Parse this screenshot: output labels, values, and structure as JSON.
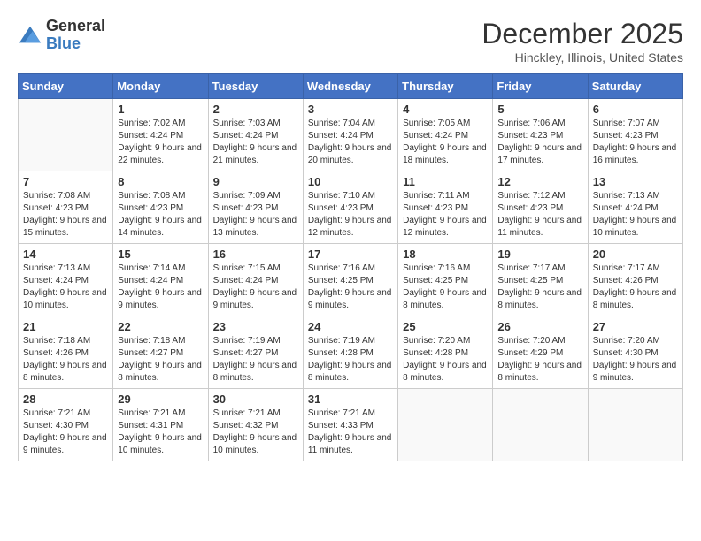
{
  "header": {
    "logo": {
      "general": "General",
      "blue": "Blue"
    },
    "title": "December 2025",
    "location": "Hinckley, Illinois, United States"
  },
  "calendar": {
    "days_of_week": [
      "Sunday",
      "Monday",
      "Tuesday",
      "Wednesday",
      "Thursday",
      "Friday",
      "Saturday"
    ],
    "weeks": [
      [
        {
          "day": null,
          "sunrise": null,
          "sunset": null,
          "daylight": null
        },
        {
          "day": "1",
          "sunrise": "7:02 AM",
          "sunset": "4:24 PM",
          "daylight": "9 hours and 22 minutes."
        },
        {
          "day": "2",
          "sunrise": "7:03 AM",
          "sunset": "4:24 PM",
          "daylight": "9 hours and 21 minutes."
        },
        {
          "day": "3",
          "sunrise": "7:04 AM",
          "sunset": "4:24 PM",
          "daylight": "9 hours and 20 minutes."
        },
        {
          "day": "4",
          "sunrise": "7:05 AM",
          "sunset": "4:24 PM",
          "daylight": "9 hours and 18 minutes."
        },
        {
          "day": "5",
          "sunrise": "7:06 AM",
          "sunset": "4:23 PM",
          "daylight": "9 hours and 17 minutes."
        },
        {
          "day": "6",
          "sunrise": "7:07 AM",
          "sunset": "4:23 PM",
          "daylight": "9 hours and 16 minutes."
        }
      ],
      [
        {
          "day": "7",
          "sunrise": "7:08 AM",
          "sunset": "4:23 PM",
          "daylight": "9 hours and 15 minutes."
        },
        {
          "day": "8",
          "sunrise": "7:08 AM",
          "sunset": "4:23 PM",
          "daylight": "9 hours and 14 minutes."
        },
        {
          "day": "9",
          "sunrise": "7:09 AM",
          "sunset": "4:23 PM",
          "daylight": "9 hours and 13 minutes."
        },
        {
          "day": "10",
          "sunrise": "7:10 AM",
          "sunset": "4:23 PM",
          "daylight": "9 hours and 12 minutes."
        },
        {
          "day": "11",
          "sunrise": "7:11 AM",
          "sunset": "4:23 PM",
          "daylight": "9 hours and 12 minutes."
        },
        {
          "day": "12",
          "sunrise": "7:12 AM",
          "sunset": "4:23 PM",
          "daylight": "9 hours and 11 minutes."
        },
        {
          "day": "13",
          "sunrise": "7:13 AM",
          "sunset": "4:24 PM",
          "daylight": "9 hours and 10 minutes."
        }
      ],
      [
        {
          "day": "14",
          "sunrise": "7:13 AM",
          "sunset": "4:24 PM",
          "daylight": "9 hours and 10 minutes."
        },
        {
          "day": "15",
          "sunrise": "7:14 AM",
          "sunset": "4:24 PM",
          "daylight": "9 hours and 9 minutes."
        },
        {
          "day": "16",
          "sunrise": "7:15 AM",
          "sunset": "4:24 PM",
          "daylight": "9 hours and 9 minutes."
        },
        {
          "day": "17",
          "sunrise": "7:16 AM",
          "sunset": "4:25 PM",
          "daylight": "9 hours and 9 minutes."
        },
        {
          "day": "18",
          "sunrise": "7:16 AM",
          "sunset": "4:25 PM",
          "daylight": "9 hours and 8 minutes."
        },
        {
          "day": "19",
          "sunrise": "7:17 AM",
          "sunset": "4:25 PM",
          "daylight": "9 hours and 8 minutes."
        },
        {
          "day": "20",
          "sunrise": "7:17 AM",
          "sunset": "4:26 PM",
          "daylight": "9 hours and 8 minutes."
        }
      ],
      [
        {
          "day": "21",
          "sunrise": "7:18 AM",
          "sunset": "4:26 PM",
          "daylight": "9 hours and 8 minutes."
        },
        {
          "day": "22",
          "sunrise": "7:18 AM",
          "sunset": "4:27 PM",
          "daylight": "9 hours and 8 minutes."
        },
        {
          "day": "23",
          "sunrise": "7:19 AM",
          "sunset": "4:27 PM",
          "daylight": "9 hours and 8 minutes."
        },
        {
          "day": "24",
          "sunrise": "7:19 AM",
          "sunset": "4:28 PM",
          "daylight": "9 hours and 8 minutes."
        },
        {
          "day": "25",
          "sunrise": "7:20 AM",
          "sunset": "4:28 PM",
          "daylight": "9 hours and 8 minutes."
        },
        {
          "day": "26",
          "sunrise": "7:20 AM",
          "sunset": "4:29 PM",
          "daylight": "9 hours and 8 minutes."
        },
        {
          "day": "27",
          "sunrise": "7:20 AM",
          "sunset": "4:30 PM",
          "daylight": "9 hours and 9 minutes."
        }
      ],
      [
        {
          "day": "28",
          "sunrise": "7:21 AM",
          "sunset": "4:30 PM",
          "daylight": "9 hours and 9 minutes."
        },
        {
          "day": "29",
          "sunrise": "7:21 AM",
          "sunset": "4:31 PM",
          "daylight": "9 hours and 10 minutes."
        },
        {
          "day": "30",
          "sunrise": "7:21 AM",
          "sunset": "4:32 PM",
          "daylight": "9 hours and 10 minutes."
        },
        {
          "day": "31",
          "sunrise": "7:21 AM",
          "sunset": "4:33 PM",
          "daylight": "9 hours and 11 minutes."
        },
        {
          "day": null,
          "sunrise": null,
          "sunset": null,
          "daylight": null
        },
        {
          "day": null,
          "sunrise": null,
          "sunset": null,
          "daylight": null
        },
        {
          "day": null,
          "sunrise": null,
          "sunset": null,
          "daylight": null
        }
      ]
    ]
  }
}
